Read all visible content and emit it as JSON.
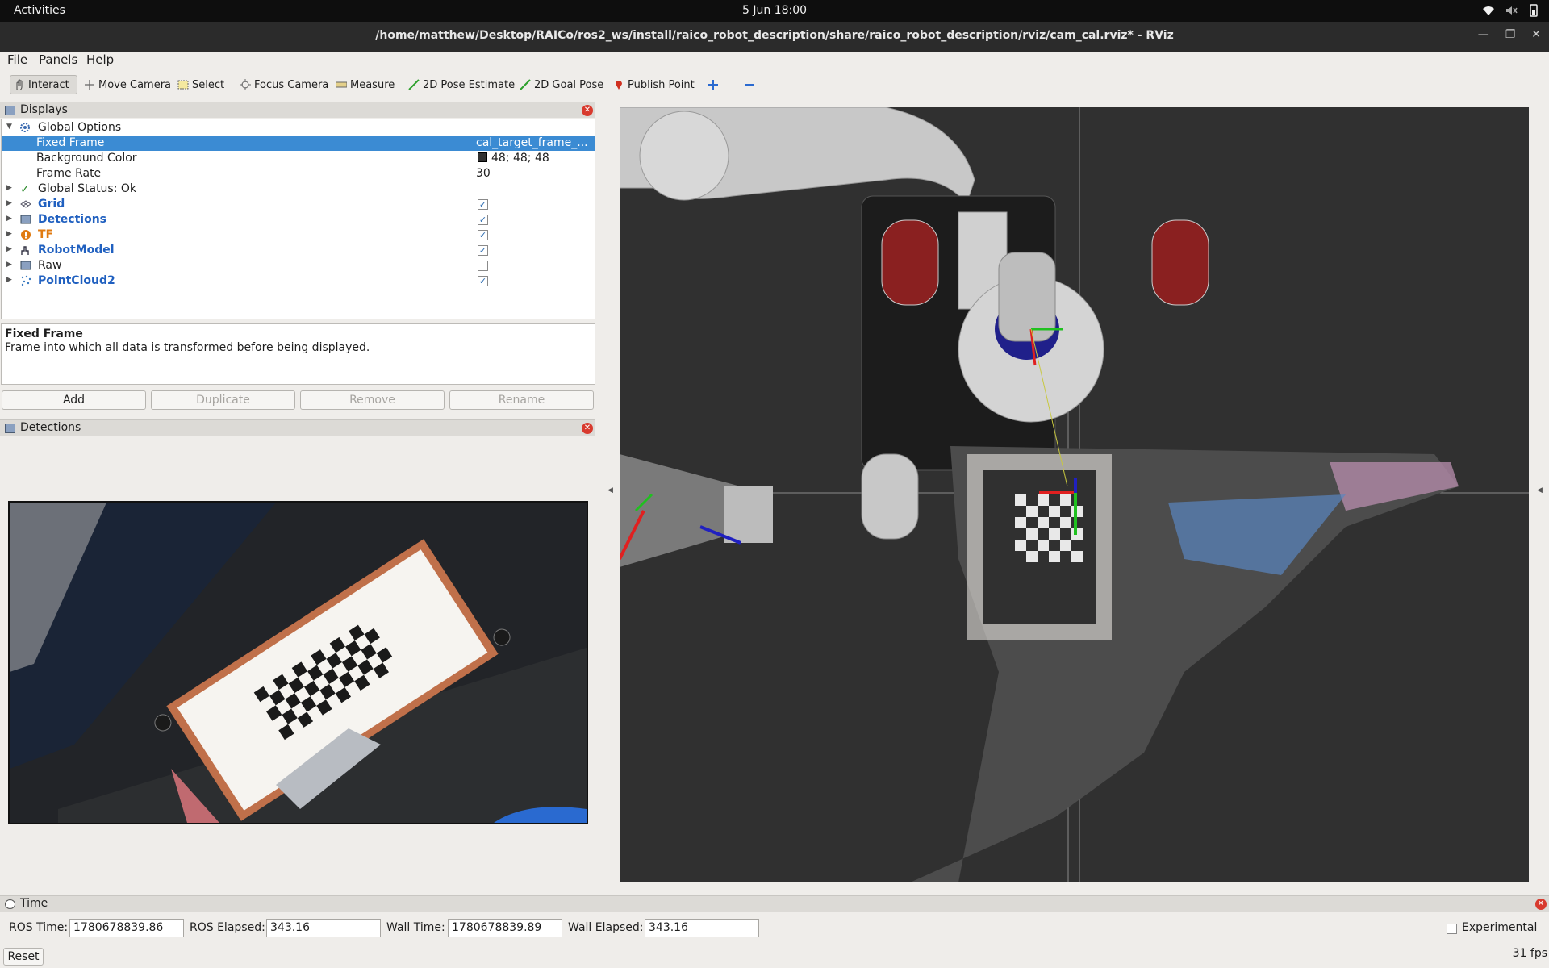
{
  "system_bar": {
    "activities": "Activities",
    "clock": "5 Jun  18:00"
  },
  "window": {
    "title": "/home/matthew/Desktop/RAICo/ros2_ws/install/raico_robot_description/share/raico_robot_description/rviz/cam_cal.rviz* - RViz"
  },
  "menu": {
    "file": "File",
    "panels": "Panels",
    "help": "Help"
  },
  "toolbar": {
    "interact": "Interact",
    "move_camera": "Move Camera",
    "select": "Select",
    "focus_camera": "Focus Camera",
    "measure": "Measure",
    "pose_estimate": "2D Pose Estimate",
    "goal_pose": "2D Goal Pose",
    "publish_point": "Publish Point"
  },
  "displays_panel": {
    "title": "Displays",
    "global_options": "Global Options",
    "fixed_frame_label": "Fixed Frame",
    "fixed_frame_value": "cal_target_frame_...",
    "background_color_label": "Background Color",
    "background_color_value": "48; 48; 48",
    "background_swatch": "#303030",
    "frame_rate_label": "Frame Rate",
    "frame_rate_value": "30",
    "global_status": "Global Status: Ok",
    "items": [
      {
        "label": "Grid",
        "checked": true
      },
      {
        "label": "Detections",
        "checked": true
      },
      {
        "label": "TF",
        "checked": true
      },
      {
        "label": "RobotModel",
        "checked": true
      },
      {
        "label": "Raw",
        "checked": false
      },
      {
        "label": "PointCloud2",
        "checked": true
      }
    ]
  },
  "description": {
    "heading": "Fixed Frame",
    "body": "Frame into which all data is transformed before being displayed."
  },
  "buttons": {
    "add": "Add",
    "duplicate": "Duplicate",
    "remove": "Remove",
    "rename": "Rename"
  },
  "detections_panel": {
    "title": "Detections"
  },
  "time_panel": {
    "title": "Time",
    "ros_time_label": "ROS Time:",
    "ros_time": "1780678839.86",
    "ros_elapsed_label": "ROS Elapsed:",
    "ros_elapsed": "343.16",
    "wall_time_label": "Wall Time:",
    "wall_time": "1780678839.89",
    "wall_elapsed_label": "Wall Elapsed:",
    "wall_elapsed": "343.16",
    "experimental": "Experimental",
    "reset": "Reset",
    "fps": "31 fps"
  },
  "colors": {
    "selection": "#3b8bd3",
    "viewport_bg": "#303030",
    "link_blue": "#2060c0",
    "warn_orange": "#e07a10"
  }
}
